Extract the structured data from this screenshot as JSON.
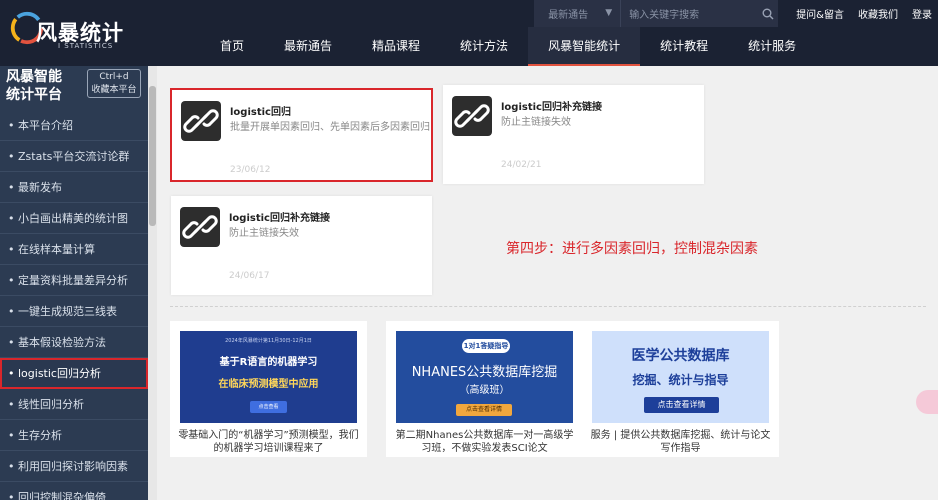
{
  "logo": {
    "text": "风暴统计",
    "sub": "I STATISTICS"
  },
  "topbar": {
    "notice_select": "最新通告",
    "search_placeholder": "输入关键字搜索",
    "links": [
      "提问&留言",
      "收藏我们",
      "登录"
    ]
  },
  "nav": {
    "items": [
      "首页",
      "最新通告",
      "精品课程",
      "统计方法",
      "风暴智能统计",
      "统计教程",
      "统计服务"
    ],
    "active_index": 4
  },
  "sidebar": {
    "title_line1": "风暴智能",
    "title_line2": "统计平台",
    "bookmark_line1": "Ctrl+d",
    "bookmark_line2": "收藏本平台",
    "items": [
      "本平台介绍",
      "Zstats平台交流讨论群",
      "最新发布",
      "小白画出精美的统计图",
      "在线样本量计算",
      "定量资料批量差异分析",
      "一键生成规范三线表",
      "基本假设检验方法",
      "logistic回归分析",
      "线性回归分析",
      "生存分析",
      "利用回归探讨影响因素",
      "回归控制混杂偏倚"
    ],
    "active_index": 8
  },
  "cards": [
    {
      "title": "logistic回归",
      "desc": "批量开展单因素回归、先单因素后多因素回归",
      "date": "23/06/12"
    },
    {
      "title": "logistic回归补充链接",
      "desc": "防止主链接失效",
      "date": "24/02/21"
    },
    {
      "title": "logistic回归补充链接",
      "desc": "防止主链接失效",
      "date": "24/06/17"
    }
  ],
  "step_text": "第四步：进行多因素回归，控制混杂因素",
  "promos": [
    {
      "img_top": "2024年风暴统计第11月30日-12月1日",
      "img_line1": "基于R语言的机器学习",
      "img_line2": "在临床预测模型中应用",
      "img_btn": "点击查看",
      "caption": "零基础入门的“机器学习”预测模型，我们的机器学习培训课程来了"
    },
    {
      "img_badge": "1对1答疑指导",
      "img_line1": "NHANES公共数据库挖掘",
      "img_line2": "（高级班）",
      "img_btn": "点击查看详情",
      "caption": "第二期Nhanes公共数据库一对一高级学习班，不做实验发表SCI论文"
    },
    {
      "img_line1": "医学公共数据库",
      "img_line2": "挖掘、统计与指导",
      "img_btn": "点击查看详情",
      "caption": "服务 | 提供公共数据库挖掘、统计与论文写作指导"
    }
  ],
  "colors": {
    "header": "#1b2233",
    "sidebar": "#2c3b52",
    "accent_red": "#d9262b",
    "nav_active_underline": "#e2533f"
  }
}
